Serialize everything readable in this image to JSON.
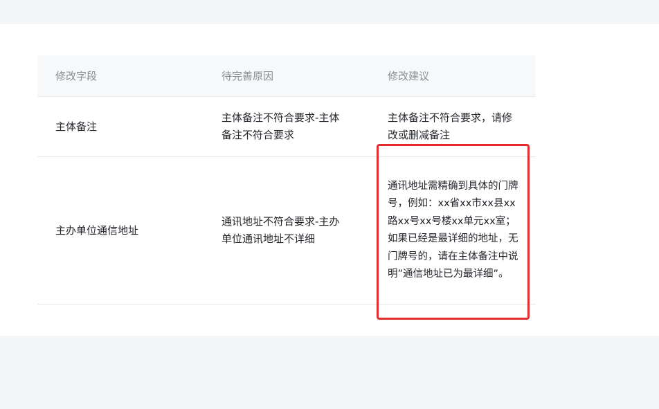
{
  "table": {
    "headers": [
      "修改字段",
      "待完善原因",
      "修改建议"
    ],
    "rows": [
      {
        "field": "主体备注",
        "reason": "主体备注不符合要求-主体备注不符合要求",
        "suggestion": "主体备注不符合要求，请修改或删减备注"
      },
      {
        "field": "主办单位通信地址",
        "reason": "通讯地址不符合要求-主办单位通讯地址不详细",
        "suggestion": "通讯地址需精确到具体的门牌号，例如：xx省xx市xx县xx路xx号xx号楼xx单元xx室；如果已经是最详细的地址，无门牌号的，请在主体备注中说明”通信地址已为最详细”。"
      }
    ]
  },
  "colors": {
    "highlight_border": "#e52b2b",
    "header_bg": "#f7f8fa",
    "page_bg": "#f4f5f7"
  }
}
